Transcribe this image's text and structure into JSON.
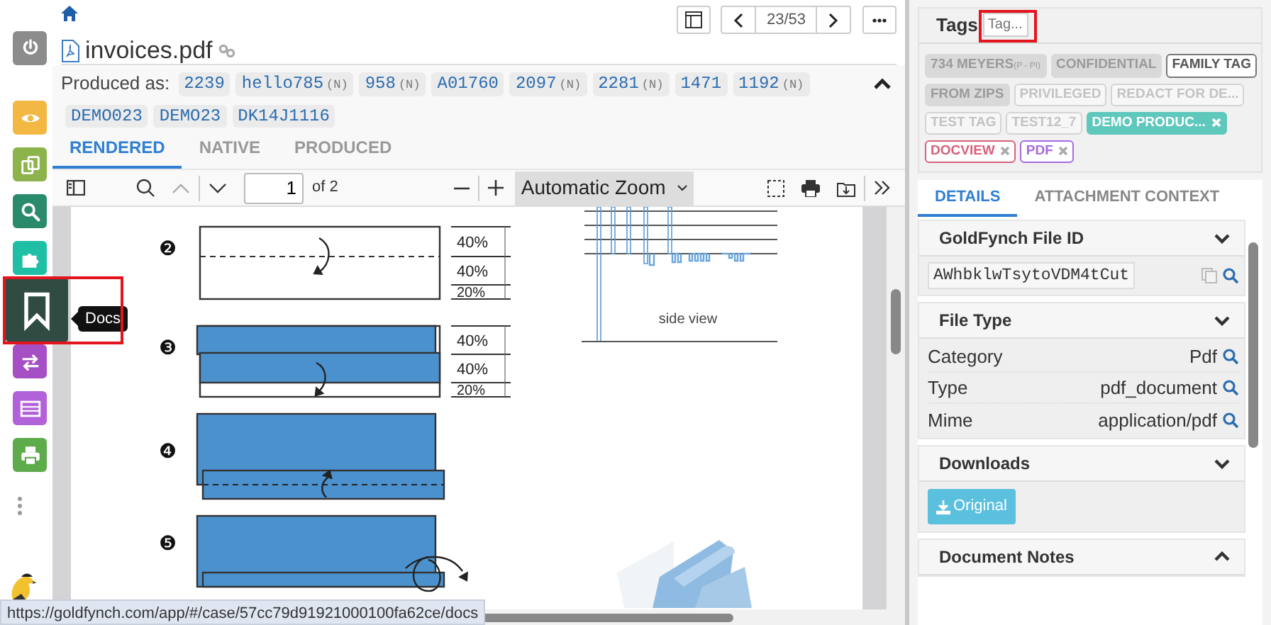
{
  "sidebar": {
    "items": [
      {
        "kind": "power",
        "color": "#8c8c8c",
        "selected": false
      },
      {
        "kind": "eye",
        "color": "#f3b743",
        "selected": false
      },
      {
        "kind": "copy",
        "color": "#8db34c",
        "selected": false
      },
      {
        "kind": "search",
        "color": "#2a8a6c",
        "selected": false
      },
      {
        "kind": "puzzle",
        "color": "#1fbfa6",
        "selected": false
      },
      {
        "kind": "bookmark",
        "color": "#2f4b42",
        "selected": true
      },
      {
        "kind": "exchange",
        "color": "#a64fc4",
        "selected": false
      },
      {
        "kind": "list",
        "color": "#b262d8",
        "selected": false
      },
      {
        "kind": "print",
        "color": "#5dab4b",
        "selected": false
      }
    ],
    "tooltip": "Docs"
  },
  "document": {
    "title": "invoices.pdf",
    "pager": "23/53"
  },
  "produced_as": {
    "label": "Produced as:",
    "expanded": true,
    "chips": [
      {
        "text": "2239"
      },
      {
        "text": "hello785",
        "suffix": "(N)"
      },
      {
        "text": "958",
        "suffix": "(N)"
      },
      {
        "text": "A01760"
      },
      {
        "text": "2097",
        "suffix": "(N)"
      },
      {
        "text": "2281",
        "suffix": "(N)"
      },
      {
        "text": "1471"
      },
      {
        "text": "1192",
        "suffix": "(N)"
      },
      {
        "text": "DEMO023"
      },
      {
        "text": "DEMO23"
      },
      {
        "text": "DK14J1116"
      }
    ]
  },
  "view_tabs": [
    {
      "label": "RENDERED",
      "selected": true
    },
    {
      "label": "NATIVE",
      "selected": false
    },
    {
      "label": "PRODUCED",
      "selected": false
    }
  ],
  "pdf_toolbar": {
    "page": "1",
    "page_count": "of 2",
    "zoom": "Automatic Zoom"
  },
  "pdf_page": {
    "steps": [
      {
        "number": "❷",
        "labels": [
          "40%",
          "40%",
          "20%"
        ]
      },
      {
        "number": "❸",
        "labels": [
          "40%",
          "40%",
          "20%"
        ]
      },
      {
        "number": "❹"
      },
      {
        "number": "❺"
      }
    ],
    "caption": "side view"
  },
  "status_url": "https://goldfynch.com/app/#/case/57cc79d91921000100fa62ce/docs",
  "tags": {
    "title": "Tags",
    "placeholder": "Tag...",
    "items": [
      {
        "label": "734 MEYERS",
        "note": "(P - PI)",
        "kind": "muted"
      },
      {
        "label": "CONFIDENTIAL",
        "kind": "muted"
      },
      {
        "label": "FAMILY TAG",
        "kind": "outlined"
      },
      {
        "label": "FROM ZIPS",
        "kind": "muted"
      },
      {
        "label": "PRIVILEGED",
        "kind": "faded"
      },
      {
        "label": "REDACT FOR DE...",
        "kind": "faded"
      },
      {
        "label": "TEST TAG",
        "kind": "faded"
      },
      {
        "label": "TEST12_7",
        "kind": "faded"
      },
      {
        "label": "DEMO PRODUC...",
        "kind": "solid",
        "color": "#5fc8bd"
      },
      {
        "label": "DOCVIEW",
        "kind": "outline",
        "color": "#d8627c"
      },
      {
        "label": "PDF",
        "kind": "outline",
        "color": "#a46cde"
      }
    ]
  },
  "detail_tabs": [
    {
      "label": "DETAILS",
      "selected": true
    },
    {
      "label": "ATTACHMENT CONTEXT",
      "selected": false
    }
  ],
  "file_id": {
    "title": "GoldFynch File ID",
    "expanded": true,
    "value": "AWhbklwTsytoVDM4tCut"
  },
  "file_type": {
    "title": "File Type",
    "expanded": true,
    "rows": [
      {
        "label": "Category",
        "value": "Pdf"
      },
      {
        "label": "Type",
        "value": "pdf_document"
      },
      {
        "label": "Mime",
        "value": "application/pdf"
      }
    ]
  },
  "downloads": {
    "title": "Downloads",
    "expanded": true,
    "button": "Original"
  },
  "notes": {
    "title": "Document Notes",
    "expanded": false
  }
}
